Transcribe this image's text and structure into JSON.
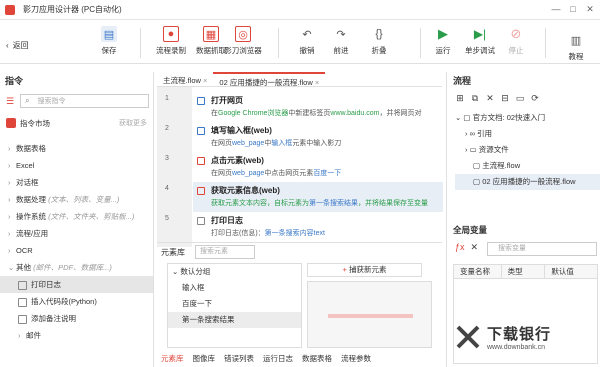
{
  "window": {
    "title": "影刀应用设计器 (PC自动化)",
    "controls": [
      "—",
      "□",
      "✕"
    ]
  },
  "toolbar": {
    "back_label": "返回",
    "buttons": [
      {
        "label": "保存",
        "icon": "save-icon"
      },
      {
        "label": "流程录制",
        "icon": "record-icon"
      },
      {
        "label": "数据抓取",
        "icon": "scrape-icon"
      },
      {
        "label": "影刀浏览器",
        "icon": "browser-icon"
      },
      {
        "label": "撤销",
        "icon": "undo-icon"
      },
      {
        "label": "前进",
        "icon": "redo-icon"
      },
      {
        "label": "折叠",
        "icon": "fold-icon"
      },
      {
        "label": "运行",
        "icon": "play-icon"
      },
      {
        "label": "单步调试",
        "icon": "step-debug-icon"
      },
      {
        "label": "停止",
        "icon": "stop-icon"
      },
      {
        "label": "教程",
        "icon": "tutorial-icon"
      }
    ]
  },
  "left_panel": {
    "title": "指令",
    "search_placeholder": "搜索指令",
    "market_label": "指令市场",
    "market_more": "获取更多",
    "items": [
      {
        "label": "数据表格",
        "sub": ""
      },
      {
        "label": "Excel",
        "sub": ""
      },
      {
        "label": "对话框",
        "sub": ""
      },
      {
        "label": "数据处理",
        "sub": "(文本、列表、变量...)"
      },
      {
        "label": "操作系统",
        "sub": "(文件、文件夹、剪贴板...)"
      },
      {
        "label": "流程/应用",
        "sub": ""
      },
      {
        "label": "OCR",
        "sub": ""
      },
      {
        "label": "其他",
        "sub": "(邮件、PDF、数据库...)"
      }
    ],
    "subitems": [
      {
        "label": "打印日志"
      },
      {
        "label": "插入代码段(Python)"
      },
      {
        "label": "添加备注说明"
      },
      {
        "label": "邮件"
      }
    ]
  },
  "editor": {
    "tabs": [
      {
        "label": "主流程.flow"
      },
      {
        "label": "02 应用播捷的一般流程.flow"
      }
    ],
    "steps": [
      {
        "num": "1",
        "title": "打开网页",
        "desc_pre": "在",
        "desc_hl": "Google Chrome浏览器",
        "desc_mid": "中新建标签页",
        "desc_hl2": "www.baidu.com",
        "desc_post": "，并将网页对"
      },
      {
        "num": "2",
        "title": "填写输入框(web)",
        "desc_pre": "在网页",
        "desc_hl": "web_page",
        "desc_mid": "中",
        "desc_hl2": "输入框",
        "desc_post": "元素中输入影刀"
      },
      {
        "num": "3",
        "title": "点击元素(web)",
        "desc_pre": "在网页",
        "desc_hl": "web_page",
        "desc_mid": "中点击网页元素",
        "desc_hl2": "百度一下",
        "desc_post": ""
      },
      {
        "num": "4",
        "title": "获取元素信息(web)",
        "desc_pre": "获取元素文本内容，自标元素为",
        "desc_hl": "第一条搜索结果",
        "desc_mid": "，并将结果保存至变量",
        "desc_hl2": "",
        "desc_post": ""
      },
      {
        "num": "5",
        "title": "打印日志",
        "desc_pre": "打印日志(信息)：",
        "desc_hl": "第一条搜索内容text",
        "desc_mid": "",
        "desc_hl2": "",
        "desc_post": ""
      }
    ]
  },
  "element_lib": {
    "title": "元素库",
    "search_placeholder": "搜索元素",
    "group_label": "数认分组",
    "items": [
      "输入框",
      "百度一下",
      "第一条搜索结果"
    ],
    "capture_label": "捕获新元素",
    "bottom_tabs": [
      "元素库",
      "图像库",
      "错误列表",
      "运行日志",
      "数据表格",
      "流程参数"
    ]
  },
  "right_panel": {
    "title": "流程",
    "doc_label": "官方文档: 02快速入门",
    "files": [
      "引用",
      "资源文件",
      "主流程.flow",
      "02 应用播捷的一般流程.flow"
    ],
    "globals_title": "全局变量",
    "globals_search_placeholder": "搜索变量",
    "table_headers": [
      "变量名称",
      "类型",
      "默认值"
    ]
  },
  "watermark": {
    "main": "下载银行",
    "sub": "www.downbank.cn"
  },
  "colors": {
    "accent": "#e0453a",
    "run_green": "#2a9d4a",
    "link_blue": "#3a78c8"
  }
}
